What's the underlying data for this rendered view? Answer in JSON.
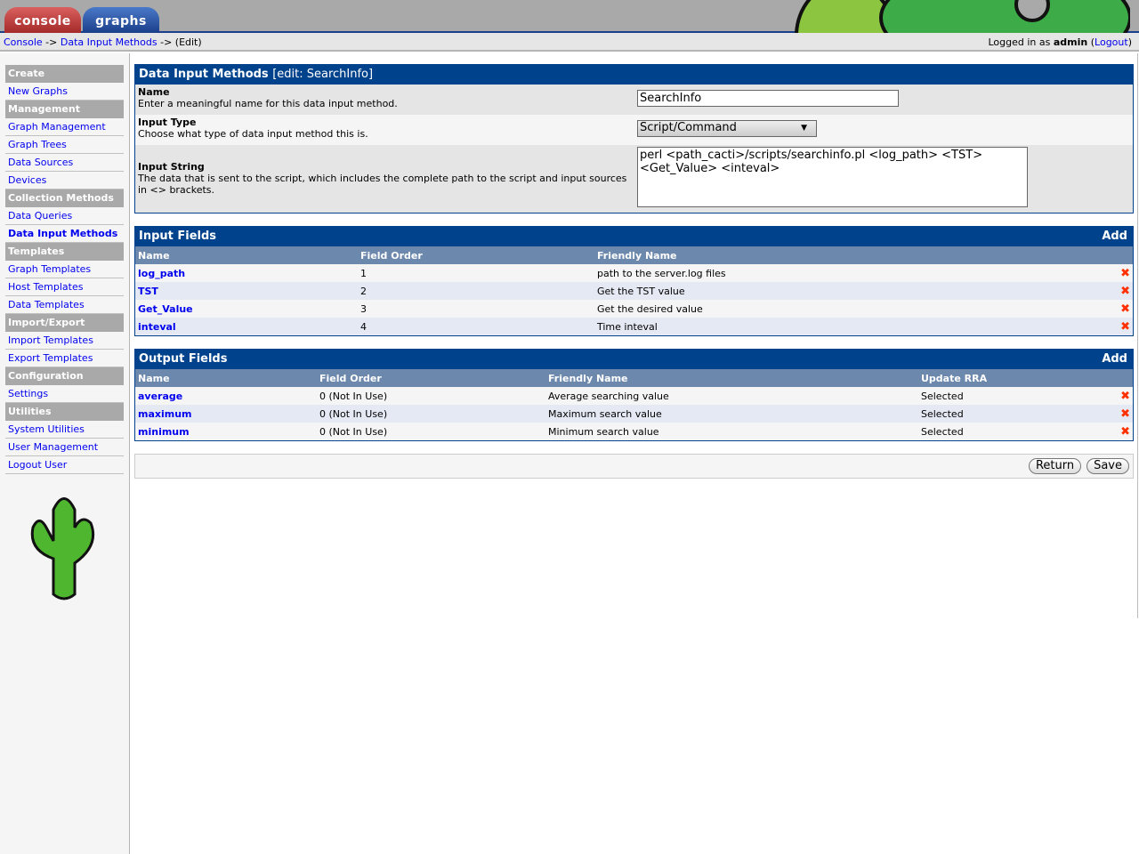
{
  "tabs": {
    "console": "console",
    "graphs": "graphs"
  },
  "breadcrumb": {
    "console": "Console",
    "sep": "->",
    "dim": "Data Input Methods",
    "edit": "(Edit)"
  },
  "login": {
    "prefix": "Logged in as",
    "user": "admin",
    "logout": "Logout"
  },
  "sidebar": [
    {
      "type": "header",
      "label": "Create"
    },
    {
      "type": "item",
      "label": "New Graphs"
    },
    {
      "type": "header",
      "label": "Management"
    },
    {
      "type": "item",
      "label": "Graph Management"
    },
    {
      "type": "item",
      "label": "Graph Trees"
    },
    {
      "type": "item",
      "label": "Data Sources"
    },
    {
      "type": "item",
      "label": "Devices"
    },
    {
      "type": "header",
      "label": "Collection Methods"
    },
    {
      "type": "item",
      "label": "Data Queries"
    },
    {
      "type": "item",
      "label": "Data Input Methods",
      "active": true
    },
    {
      "type": "header",
      "label": "Templates"
    },
    {
      "type": "item",
      "label": "Graph Templates"
    },
    {
      "type": "item",
      "label": "Host Templates"
    },
    {
      "type": "item",
      "label": "Data Templates"
    },
    {
      "type": "header",
      "label": "Import/Export"
    },
    {
      "type": "item",
      "label": "Import Templates"
    },
    {
      "type": "item",
      "label": "Export Templates"
    },
    {
      "type": "header",
      "label": "Configuration"
    },
    {
      "type": "item",
      "label": "Settings"
    },
    {
      "type": "header",
      "label": "Utilities"
    },
    {
      "type": "item",
      "label": "System Utilities"
    },
    {
      "type": "item",
      "label": "User Management"
    },
    {
      "type": "item",
      "label": "Logout User"
    }
  ],
  "form": {
    "title": "Data Input Methods",
    "subtitle": "[edit: SearchInfo]",
    "name_label": "Name",
    "name_desc": "Enter a meaningful name for this data input method.",
    "name_value": "SearchInfo",
    "type_label": "Input Type",
    "type_desc": "Choose what type of data input method this is.",
    "type_value": "Script/Command",
    "string_label": "Input String",
    "string_desc": "The data that is sent to the script, which includes the complete path to the script and input sources in <> brackets.",
    "string_value": "perl <path_cacti>/scripts/searchinfo.pl <log_path> <TST> <Get_Value> <inteval>"
  },
  "input_fields": {
    "title": "Input Fields",
    "add": "Add",
    "columns": [
      "Name",
      "Field Order",
      "Friendly Name"
    ],
    "rows": [
      [
        "log_path",
        "1",
        "path to the server.log files"
      ],
      [
        "TST",
        "2",
        "Get the TST value"
      ],
      [
        "Get_Value",
        "3",
        "Get the desired value"
      ],
      [
        "inteval",
        "4",
        "Time inteval"
      ]
    ]
  },
  "output_fields": {
    "title": "Output Fields",
    "add": "Add",
    "columns": [
      "Name",
      "Field Order",
      "Friendly Name",
      "Update RRA"
    ],
    "rows": [
      [
        "average",
        "0 (Not In Use)",
        "Average searching value",
        "Selected"
      ],
      [
        "maximum",
        "0 (Not In Use)",
        "Maximum search value",
        "Selected"
      ],
      [
        "minimum",
        "0 (Not In Use)",
        "Minimum search value",
        "Selected"
      ]
    ]
  },
  "delete_icon": "✖",
  "buttons": {
    "return": "Return",
    "save": "Save"
  }
}
